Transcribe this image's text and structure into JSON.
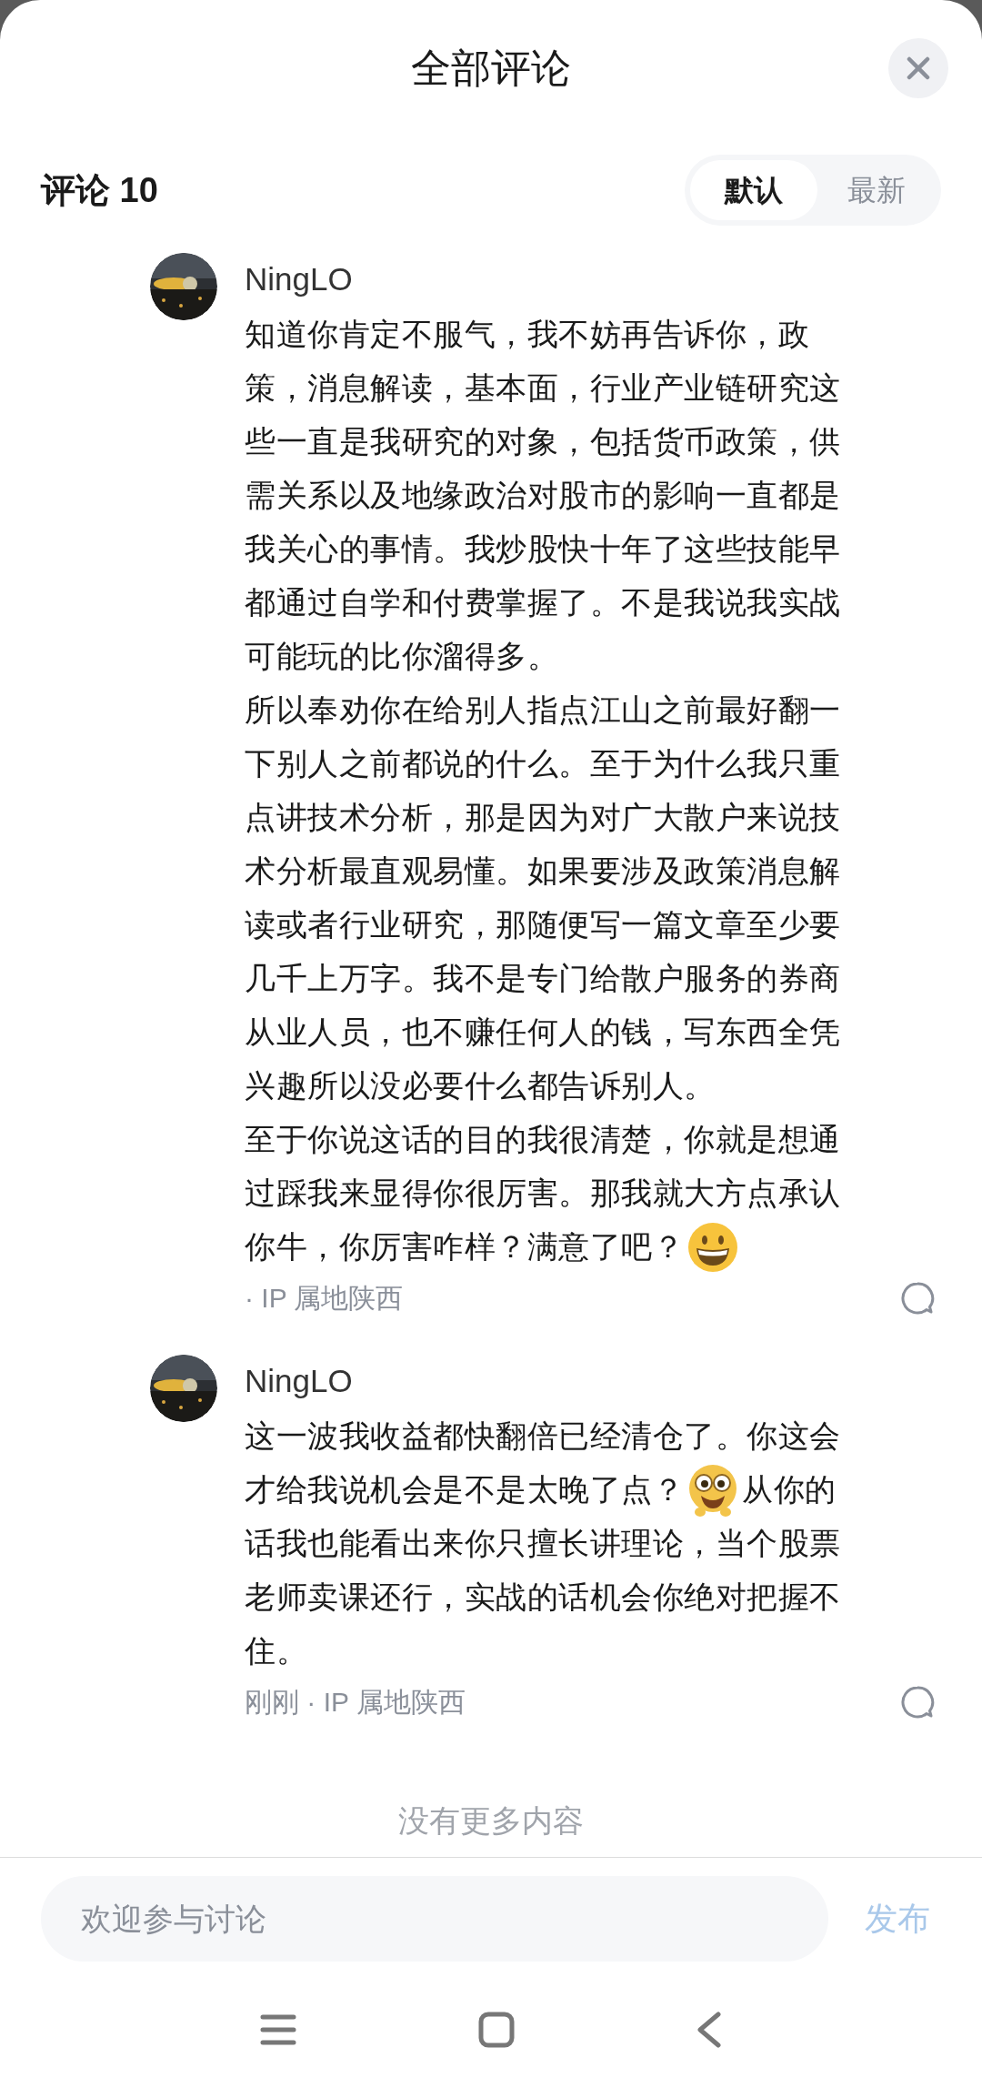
{
  "sheet": {
    "title": "全部评论"
  },
  "comments_header": {
    "label": "评论 10",
    "sort_tabs": [
      {
        "label": "默认",
        "selected": true
      },
      {
        "label": "最新",
        "selected": false
      }
    ]
  },
  "comments": [
    {
      "author": "NingLO",
      "lines": [
        [
          {
            "kind": "text",
            "text": "知道你肯定不服气，我不妨再告诉你，政"
          }
        ],
        [
          {
            "kind": "text",
            "text": "策，消息解读，基本面，行业产业链研究这"
          }
        ],
        [
          {
            "kind": "text",
            "text": "些一直是我研究的对象，包括货币政策，供"
          }
        ],
        [
          {
            "kind": "text",
            "text": "需关系以及地缘政治对股市的影响一直都是"
          }
        ],
        [
          {
            "kind": "text",
            "text": "我关心的事情。我炒股快十年了这些技能早"
          }
        ],
        [
          {
            "kind": "text",
            "text": "都通过自学和付费掌握了。不是我说我实战"
          }
        ],
        [
          {
            "kind": "text",
            "text": "可能玩的比你溜得多。"
          }
        ],
        [
          {
            "kind": "text",
            "text": "所以奉劝你在给别人指点江山之前最好翻一"
          }
        ],
        [
          {
            "kind": "text",
            "text": "下别人之前都说的什么。至于为什么我只重"
          }
        ],
        [
          {
            "kind": "text",
            "text": "点讲技术分析，那是因为对广大散户来说技"
          }
        ],
        [
          {
            "kind": "text",
            "text": "术分析最直观易懂。如果要涉及政策消息解"
          }
        ],
        [
          {
            "kind": "text",
            "text": "读或者行业研究，那随便写一篇文章至少要"
          }
        ],
        [
          {
            "kind": "text",
            "text": "几千上万字。我不是专门给散户服务的券商"
          }
        ],
        [
          {
            "kind": "text",
            "text": "从业人员，也不赚任何人的钱，写东西全凭"
          }
        ],
        [
          {
            "kind": "text",
            "text": "兴趣所以没必要什么都告诉别人。"
          }
        ],
        [
          {
            "kind": "text",
            "text": "至于你说这话的目的我很清楚，你就是想通"
          }
        ],
        [
          {
            "kind": "text",
            "text": "过踩我来显得你很厉害。那我就大方点承认"
          }
        ],
        [
          {
            "kind": "text",
            "text": "你牛，你厉害咋样？满意了吧？"
          },
          {
            "kind": "grin"
          }
        ]
      ],
      "meta": "· IP 属地陕西"
    },
    {
      "author": "NingLO",
      "lines": [
        [
          {
            "kind": "text",
            "text": "这一波我收益都快翻倍已经清仓了。你这会"
          }
        ],
        [
          {
            "kind": "text",
            "text": "才给我说机会是不是太晚了点？"
          },
          {
            "kind": "goggle"
          },
          {
            "kind": "text",
            "text": "从你的"
          }
        ],
        [
          {
            "kind": "text",
            "text": "话我也能看出来你只擅长讲理论，当个股票"
          }
        ],
        [
          {
            "kind": "text",
            "text": "老师卖课还行，实战的话机会你绝对把握不"
          }
        ],
        [
          {
            "kind": "text",
            "text": "住。"
          }
        ]
      ],
      "meta": "刚刚 · IP 属地陕西"
    }
  ],
  "end_note": "没有更多内容",
  "composer": {
    "placeholder": "欢迎参与讨论",
    "post_button": "发布"
  }
}
